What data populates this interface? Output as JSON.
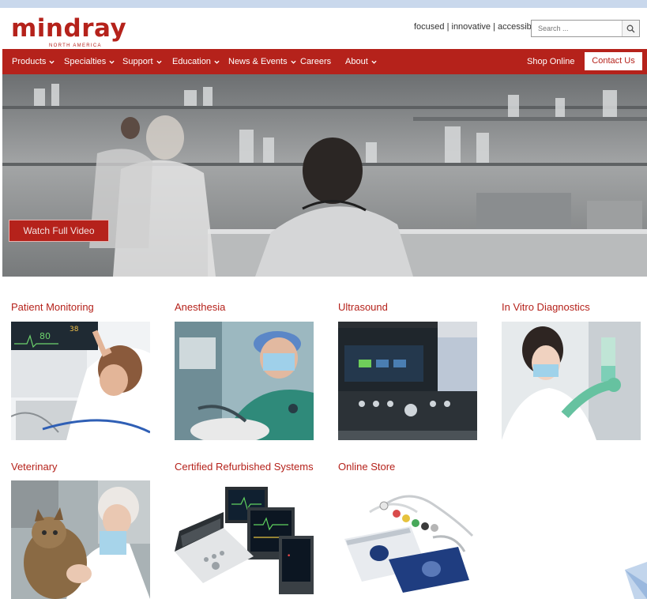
{
  "brand": {
    "name": "mindray",
    "subtitle": "NORTH AMERICA",
    "color": "#b5221b"
  },
  "header": {
    "tagline": "focused | innovative | accessible",
    "search_placeholder": "Search ..."
  },
  "nav": {
    "items": [
      {
        "label": "Products",
        "dropdown": true
      },
      {
        "label": "Specialties",
        "dropdown": true
      },
      {
        "label": "Support",
        "dropdown": true
      },
      {
        "label": "Education",
        "dropdown": true
      },
      {
        "label": "News & Events",
        "dropdown": true
      },
      {
        "label": "Careers",
        "dropdown": false
      },
      {
        "label": "About",
        "dropdown": true
      }
    ],
    "shop_online": "Shop Online",
    "contact_us": "Contact Us"
  },
  "hero": {
    "video_button": "Watch Full Video"
  },
  "categories": [
    {
      "title": "Patient Monitoring",
      "image": "patient-monitoring-photo"
    },
    {
      "title": "Anesthesia",
      "image": "anesthesia-photo"
    },
    {
      "title": "Ultrasound",
      "image": "ultrasound-photo"
    },
    {
      "title": "In Vitro Diagnostics",
      "image": "in-vitro-diagnostics-photo"
    },
    {
      "title": "Veterinary",
      "image": "veterinary-photo"
    },
    {
      "title": "Certified Refurbished Systems",
      "image": "refurbished-systems-photo"
    },
    {
      "title": "Online Store",
      "image": "online-store-photo"
    }
  ],
  "monitor_display": {
    "reading_1": "80",
    "reading_2": "38"
  }
}
